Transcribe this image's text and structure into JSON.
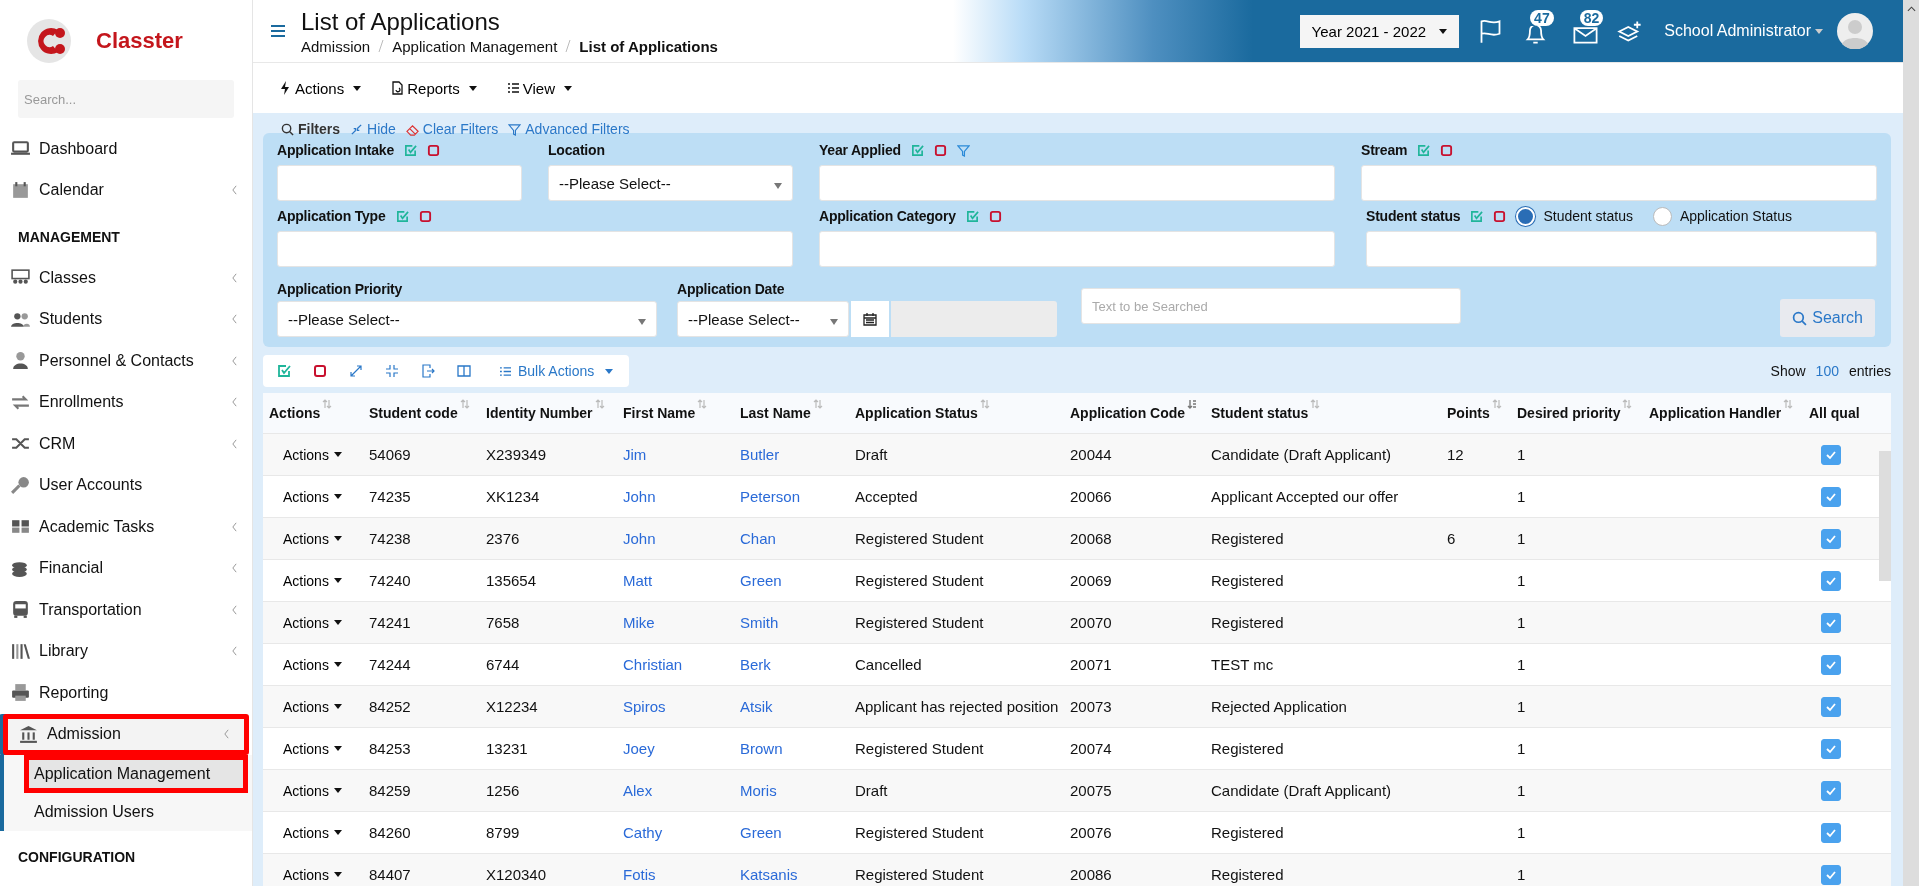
{
  "brand": {
    "name": "Classter"
  },
  "sidebar": {
    "search": {
      "placeholder": "Search..."
    },
    "sections": [
      {
        "items": [
          {
            "label": "Dashboard",
            "arrow": false,
            "highlighted": false
          },
          {
            "label": "Calendar",
            "arrow": true,
            "highlighted": false
          }
        ]
      },
      {
        "title": "MANAGEMENT",
        "items": [
          {
            "label": "Classes",
            "arrow": true,
            "highlighted": false
          },
          {
            "label": "Students",
            "arrow": true,
            "highlighted": false
          },
          {
            "label": "Personnel & Contacts",
            "arrow": true,
            "highlighted": false
          },
          {
            "label": "Enrollments",
            "arrow": true,
            "highlighted": false
          },
          {
            "label": "CRM",
            "arrow": true,
            "highlighted": false
          },
          {
            "label": "User Accounts",
            "arrow": false,
            "highlighted": false
          },
          {
            "label": "Academic Tasks",
            "arrow": true,
            "highlighted": false
          },
          {
            "label": "Financial",
            "arrow": true,
            "highlighted": false
          },
          {
            "label": "Transportation",
            "arrow": true,
            "highlighted": false
          },
          {
            "label": "Library",
            "arrow": true,
            "highlighted": false
          },
          {
            "label": "Reporting",
            "arrow": false,
            "highlighted": false
          },
          {
            "label": "Admission",
            "arrow": true,
            "highlighted": true,
            "expanded": true,
            "children": [
              {
                "label": "Application Management",
                "selected": true,
                "highlighted": true
              },
              {
                "label": "Admission Users",
                "selected": false,
                "highlighted": false
              }
            ]
          }
        ]
      },
      {
        "title": "CONFIGURATION"
      }
    ]
  },
  "header": {
    "title": "List of Applications",
    "breadcrumb": [
      "Admission",
      "Application Management",
      "List of Applications"
    ],
    "year": "Year 2021 - 2022",
    "notifications": "47",
    "messages": "82",
    "user": "School Administrator"
  },
  "toolbar": [
    {
      "label": "Actions"
    },
    {
      "label": "Reports"
    },
    {
      "label": "View"
    }
  ],
  "filter_bar": {
    "title": "Filters",
    "links": [
      {
        "label": "Hide"
      },
      {
        "label": "Clear Filters"
      },
      {
        "label": "Advanced Filters"
      }
    ]
  },
  "filters": [
    {
      "label": "Application Intake",
      "kind": "text",
      "tools": true,
      "funnel": false
    },
    {
      "label": "Location",
      "kind": "select",
      "value": "--Please Select--",
      "tools": false,
      "funnel": false
    },
    {
      "label": "Year Applied",
      "kind": "text",
      "tools": true,
      "funnel": true
    },
    {
      "label": "Stream",
      "kind": "text",
      "tools": true,
      "funnel": false
    },
    {
      "label": "Application Type",
      "kind": "text",
      "tools": true,
      "funnel": false
    },
    {
      "label": "Application Category",
      "kind": "text",
      "tools": true,
      "funnel": false
    },
    {
      "label": "Student status",
      "kind": "radio",
      "tools": true,
      "funnel": false,
      "options": [
        {
          "label": "Student status",
          "selected": true
        },
        {
          "label": "Application Status",
          "selected": false
        }
      ]
    }
  ],
  "filters_bottom": {
    "priority": {
      "label": "Application Priority",
      "value": "--Please Select--"
    },
    "date": {
      "label": "Application Date",
      "value": "--Please Select--"
    },
    "search": {
      "placeholder": "Text to be Searched"
    },
    "button": "Search"
  },
  "table_tools": {
    "bulk": "Bulk Actions",
    "show": "Show",
    "entries_count": "100",
    "entries": "entries"
  },
  "table": {
    "columns": [
      "Actions",
      "Student code",
      "Identity Number",
      "First Name",
      "Last Name",
      "Application Status",
      "Application Code",
      "Student status",
      "Points",
      "Desired priority",
      "Application Handler",
      "All qual"
    ],
    "rows": [
      {
        "action": "Actions",
        "code": "54069",
        "id": "X239349",
        "first": "Jim",
        "last": "Butler",
        "app_status": "Draft",
        "app_code": "20044",
        "student_status": "Candidate (Draft Applicant)",
        "points": "12",
        "priority": "1",
        "checked": true
      },
      {
        "action": "Actions",
        "code": "74235",
        "id": "XK1234",
        "first": "John",
        "last": "Peterson",
        "app_status": "Accepted",
        "app_code": "20066",
        "student_status": "Applicant Accepted our offer",
        "priority": "1",
        "checked": true
      },
      {
        "action": "Actions",
        "code": "74238",
        "id": "2376",
        "first": "John",
        "last": "Chan",
        "app_status": "Registered Student",
        "app_code": "20068",
        "student_status": "Registered",
        "points": "6",
        "priority": "1",
        "checked": true
      },
      {
        "action": "Actions",
        "code": "74240",
        "id": "135654",
        "first": "Matt",
        "last": "Green",
        "app_status": "Registered Student",
        "app_code": "20069",
        "student_status": "Registered",
        "priority": "1",
        "checked": true
      },
      {
        "action": "Actions",
        "code": "74241",
        "id": "7658",
        "first": "Mike",
        "last": "Smith",
        "app_status": "Registered Student",
        "app_code": "20070",
        "student_status": "Registered",
        "priority": "1",
        "checked": true
      },
      {
        "action": "Actions",
        "code": "74244",
        "id": "6744",
        "first": "Christian",
        "last": "Berk",
        "app_status": "Cancelled",
        "app_code": "20071",
        "student_status": "TEST mc",
        "priority": "1",
        "checked": true
      },
      {
        "action": "Actions",
        "code": "84252",
        "id": "X12234",
        "first": "Spiros",
        "last": "Atsik",
        "app_status": "Applicant has rejected position",
        "app_code": "20073",
        "student_status": "Rejected Application",
        "priority": "1",
        "checked": true
      },
      {
        "action": "Actions",
        "code": "84253",
        "id": "13231",
        "first": "Joey",
        "last": "Brown",
        "app_status": "Registered Student",
        "app_code": "20074",
        "student_status": "Registered",
        "priority": "1",
        "checked": true
      },
      {
        "action": "Actions",
        "code": "84259",
        "id": "1256",
        "first": "Alex",
        "last": "Moris",
        "app_status": "Draft",
        "app_code": "20075",
        "student_status": "Candidate (Draft Applicant)",
        "priority": "1",
        "checked": true
      },
      {
        "action": "Actions",
        "code": "84260",
        "id": "8799",
        "first": "Cathy",
        "last": "Green",
        "app_status": "Registered Student",
        "app_code": "20076",
        "student_status": "Registered",
        "priority": "1",
        "checked": true
      },
      {
        "action": "Actions",
        "code": "84407",
        "id": "X120340",
        "first": "Fotis",
        "last": "Katsanis",
        "app_status": "Registered Student",
        "app_code": "20086",
        "student_status": "Registered",
        "priority": "1",
        "checked": true
      }
    ]
  }
}
